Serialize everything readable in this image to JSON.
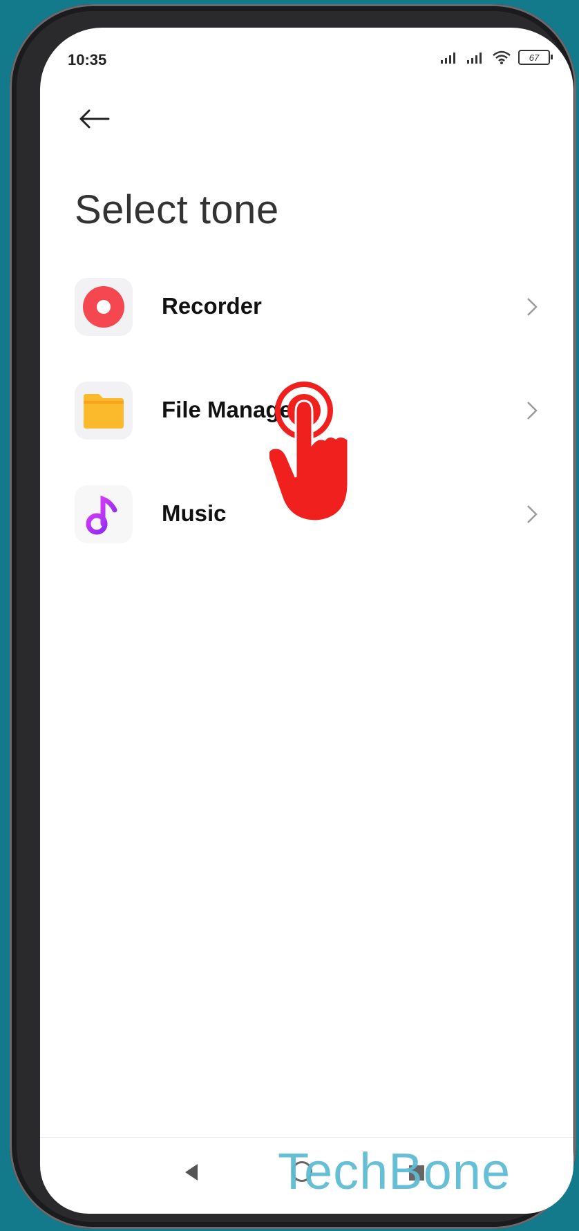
{
  "status_bar": {
    "time": "10:35",
    "battery": "67"
  },
  "page": {
    "title": "Select tone"
  },
  "items": [
    {
      "label": "Recorder",
      "icon": "recorder-icon"
    },
    {
      "label": "File Manager",
      "icon": "folder-icon"
    },
    {
      "label": "Music",
      "icon": "music-note-icon"
    }
  ],
  "watermark": "TechBone",
  "colors": {
    "recorder": "#f4474f",
    "folder": "#fbb92c",
    "music": "#b22cf0",
    "watermark": "#5fbcd3",
    "hand": "#f0201f",
    "background": "#137a8b"
  }
}
